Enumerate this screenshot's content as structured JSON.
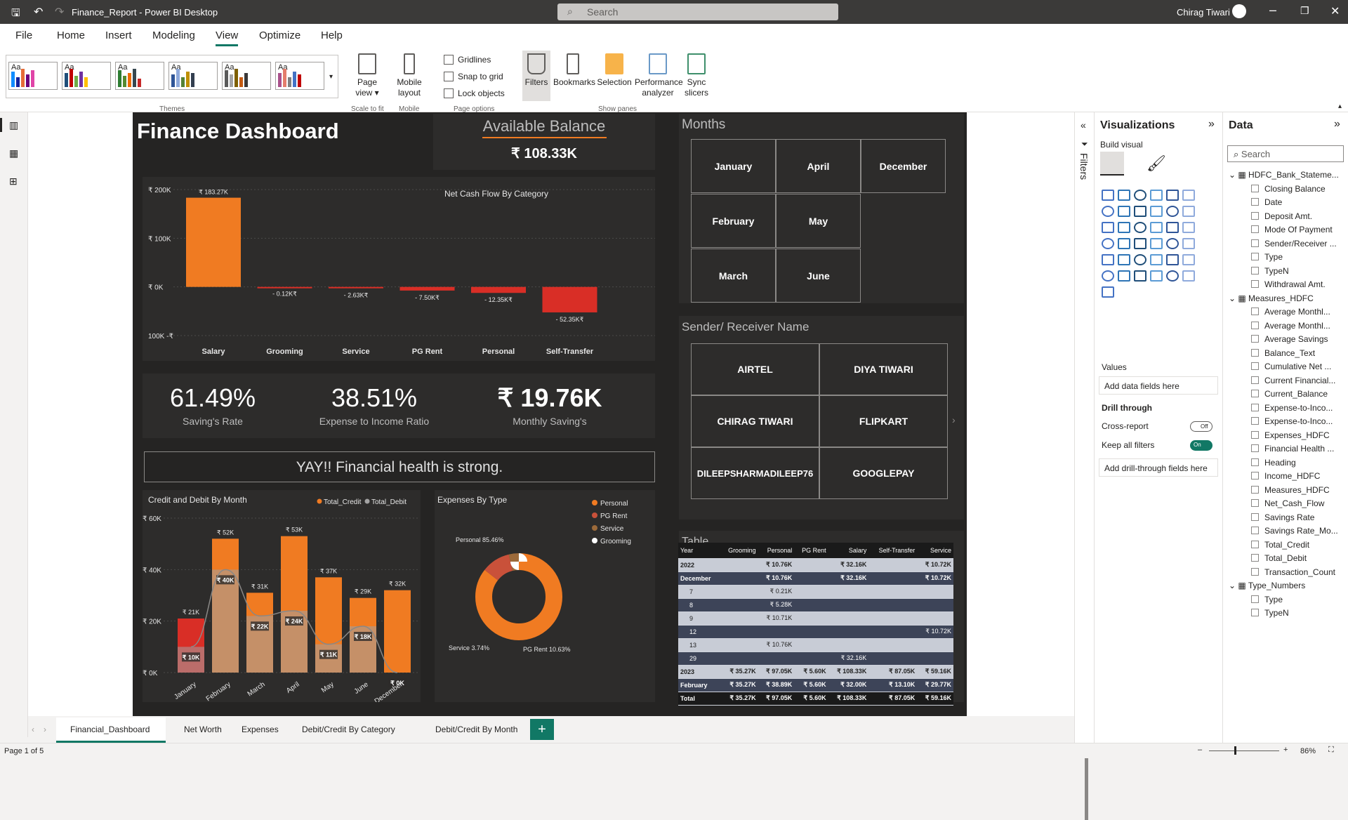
{
  "app": {
    "title": "Finance_Report - Power BI Desktop",
    "search_placeholder": "Search",
    "user": "Chirag Tiwari"
  },
  "ribbon": {
    "tabs": [
      "File",
      "Home",
      "Insert",
      "Modeling",
      "View",
      "Optimize",
      "Help"
    ],
    "active_tab": "View",
    "groups": [
      "Themes",
      "Scale to fit",
      "Mobile",
      "Page options",
      "Show panes"
    ],
    "buttons": {
      "page_view": "Page view",
      "mobile_layout": "Mobile layout",
      "filters": "Filters",
      "bookmarks": "Bookmarks",
      "selection": "Selection",
      "performance": "Performance analyzer",
      "sync": "Sync slicers"
    },
    "checkboxes": [
      "Gridlines",
      "Snap to grid",
      "Lock objects"
    ]
  },
  "dashboard": {
    "title": "Finance Dashboard",
    "balance_label": "Available Balance",
    "balance_value": "₹ 108.33K",
    "kpis": [
      {
        "value": "61.49%",
        "label": "Saving's Rate"
      },
      {
        "value": "38.51%",
        "label": "Expense to Income Ratio"
      },
      {
        "value": "₹ 19.76K",
        "label": "Monthly Saving's"
      }
    ],
    "health_message": "YAY!! Financial health is strong.",
    "months_title": "Months",
    "months": [
      "January",
      "April",
      "December",
      "February",
      "May",
      "March",
      "June"
    ],
    "sender_title": "Sender/ Receiver Name",
    "senders": [
      "AIRTEL",
      "DIYA TIWARI",
      "CHIRAG TIWARI",
      "FLIPKART",
      "DILEEPSHARMADILEEP76",
      "GOOGLEPAY"
    ],
    "table_title": "Table",
    "table": {
      "headers": [
        "Year",
        "Grooming",
        "Personal",
        "PG Rent",
        "Salary",
        "Self-Transfer",
        "Service"
      ],
      "rows": [
        [
          "2022",
          "",
          "₹ 10.76K",
          "",
          "₹ 32.16K",
          "",
          "₹ 10.72K"
        ],
        [
          "December",
          "",
          "₹ 10.76K",
          "",
          "₹ 32.16K",
          "",
          "₹ 10.72K"
        ],
        [
          "7",
          "",
          "₹ 0.21K",
          "",
          "",
          "",
          ""
        ],
        [
          "8",
          "",
          "₹ 5.28K",
          "",
          "",
          "",
          ""
        ],
        [
          "9",
          "",
          "₹ 10.71K",
          "",
          "",
          "",
          ""
        ],
        [
          "12",
          "",
          "",
          "",
          "",
          "",
          "₹ 10.72K"
        ],
        [
          "13",
          "",
          "₹ 10.76K",
          "",
          "",
          "",
          ""
        ],
        [
          "29",
          "",
          "",
          "",
          "₹ 32.16K",
          "",
          ""
        ],
        [
          "2023",
          "₹ 35.27K",
          "₹ 97.05K",
          "₹ 5.60K",
          "₹ 108.33K",
          "₹ 87.05K",
          "₹ 59.16K"
        ],
        [
          "February",
          "₹ 35.27K",
          "₹ 38.89K",
          "₹ 5.60K",
          "₹ 32.00K",
          "₹ 13.10K",
          "₹ 29.77K"
        ],
        [
          "Total",
          "₹ 35.27K",
          "₹ 97.05K",
          "₹ 5.60K",
          "₹ 108.33K",
          "₹ 87.05K",
          "₹ 59.16K"
        ]
      ]
    }
  },
  "chart_data": [
    {
      "type": "bar",
      "title": "Net Cash Flow By Category",
      "categories": [
        "Salary",
        "Grooming",
        "Service",
        "PG Rent",
        "Personal",
        "Self-Transfer"
      ],
      "values": [
        183.27,
        -0.12,
        -2.63,
        -7.5,
        -12.35,
        -52.35
      ],
      "labels": [
        "₹ 183.27K",
        "- 0.12K₹",
        "- 2.63K₹",
        "- 7.50K₹",
        "- 12.35K₹",
        "- 52.35K₹"
      ],
      "y_ticks": [
        "₹ 200K",
        "₹ 100K",
        "₹ 0K",
        "100K -₹"
      ],
      "ylim": [
        -100,
        200
      ],
      "colors": {
        "positive": "#f07b22",
        "negative": "#d92e26"
      }
    },
    {
      "type": "bar",
      "title": "Credit and Debit By Month",
      "categories": [
        "January",
        "February",
        "March",
        "April",
        "May",
        "June",
        "December"
      ],
      "series": [
        {
          "name": "Total_Credit",
          "values": [
            21,
            52,
            31,
            53,
            37,
            29,
            32
          ],
          "labels": [
            "₹ 21K",
            "₹ 52K",
            "₹ 31K",
            "₹ 53K",
            "₹ 37K",
            "₹ 29K",
            "₹ 32K"
          ]
        },
        {
          "name": "Total_Debit",
          "values": [
            10,
            40,
            22,
            24,
            11,
            18,
            0
          ],
          "labels": [
            "₹ 10K",
            "₹ 40K",
            "₹ 22K",
            "₹ 24K",
            "₹ 11K",
            "₹ 18K",
            "₹ 0K"
          ]
        }
      ],
      "y_ticks": [
        "₹ 60K",
        "₹ 40K",
        "₹ 20K",
        "₹ 0K"
      ],
      "ylim": [
        0,
        60
      ],
      "colors": {
        "credit": "#f07b22",
        "debit": "#a3a3a3",
        "first_bar": "#d92e26"
      }
    },
    {
      "type": "pie",
      "title": "Expenses By Type",
      "slices": [
        {
          "name": "Personal",
          "value": 85.46,
          "label": "Personal 85.46%",
          "color": "#f07b22"
        },
        {
          "name": "PG Rent",
          "value": 10.63,
          "label": "PG Rent 10.63%",
          "color": "#c9513a"
        },
        {
          "name": "Service",
          "value": 3.74,
          "label": "Service 3.74%",
          "color": "#9c6a3a"
        },
        {
          "name": "Grooming",
          "value": 0.17,
          "label": "",
          "color": "#ffffff"
        }
      ]
    }
  ],
  "visualizations": {
    "title": "Visualizations",
    "build_visual": "Build visual",
    "values_label": "Values",
    "add_data": "Add data fields here",
    "drill_title": "Drill through",
    "cross_report": "Cross-report",
    "cross_state": "Off",
    "keep_filters": "Keep all filters",
    "keep_state": "On",
    "add_drill": "Add drill-through fields here"
  },
  "data_pane": {
    "title": "Data",
    "search_placeholder": "Search",
    "filters_label": "Filters",
    "tables": [
      {
        "name": "HDFC_Bank_Stateme...",
        "fields": [
          "Closing Balance",
          "Date",
          "Deposit Amt.",
          "Mode Of Payment",
          "Sender/Receiver ...",
          "Type",
          "TypeN",
          "Withdrawal Amt."
        ]
      },
      {
        "name": "Measures_HDFC",
        "fields": [
          "Average Monthl...",
          "Average Monthl...",
          "Average Savings",
          "Balance_Text",
          "Cumulative Net ...",
          "Current Financial...",
          "Current_Balance",
          "Expense-to-Inco...",
          "Expense-to-Inco...",
          "Expenses_HDFC",
          "Financial Health ...",
          "Heading",
          "Income_HDFC",
          "Measures_HDFC",
          "Net_Cash_Flow",
          "Savings Rate",
          "Savings Rate_Mo...",
          "Total_Credit",
          "Total_Debit",
          "Transaction_Count"
        ]
      },
      {
        "name": "Type_Numbers",
        "fields": [
          "Type",
          "TypeN"
        ]
      }
    ]
  },
  "pages": [
    "Financial_Dashboard",
    "Net Worth",
    "Expenses",
    "Debit/Credit By Category",
    "Debit/Credit By Month"
  ],
  "status": {
    "page": "Page 1 of 5",
    "zoom": "86%"
  }
}
